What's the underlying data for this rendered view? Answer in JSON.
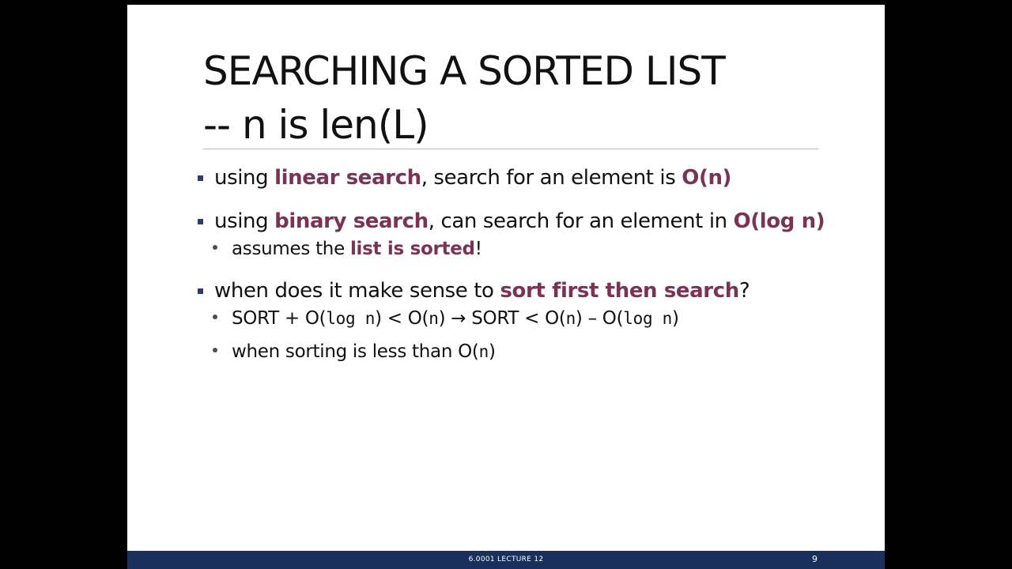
{
  "slide": {
    "title_line1": "SEARCHING A SORTED LIST",
    "title_line2": "-- n is len(L)"
  },
  "bullets": {
    "b1": {
      "t1": "using ",
      "h1": "linear search",
      "t2": ", search for an element is ",
      "h2": "O(n)"
    },
    "b2": {
      "t1": "using ",
      "h1": "binary search",
      "t2": ", can search for an element in ",
      "h2": "O(log n)"
    },
    "b2_sub": {
      "t1": "assumes the ",
      "h1": "list is sorted",
      "t2": "!"
    },
    "b3": {
      "t1": "when does it make sense to ",
      "h1": "sort first then search",
      "t2": "?"
    },
    "b3_sub1": {
      "s1": "SORT + O(",
      "m1": "log n",
      "s2": ") < O(",
      "m2": "n",
      "s3": ") → SORT < O(",
      "m3": "n",
      "s4": ") – O(",
      "m4": "log n",
      "s5": ")"
    },
    "b3_sub2": {
      "s1": "when sorting is less than O(",
      "m1": "n",
      "s2": ")"
    }
  },
  "footer": {
    "text": "6.0001 LECTURE 12",
    "page_number": "9"
  },
  "colors": {
    "highlight": "#7a3355",
    "footer_bar": "#1b2f5c",
    "bullet_marker": "#303a70"
  }
}
